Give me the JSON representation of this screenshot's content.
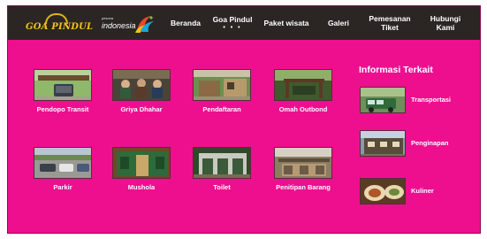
{
  "brand": {
    "logo_text": "GOA PINDUL",
    "partner_small": "pesona",
    "partner_name": "indonesia"
  },
  "nav": {
    "items": [
      {
        "label": "Beranda"
      },
      {
        "label": "Goa Pindul",
        "dots": "• • •"
      },
      {
        "label": "Paket wisata"
      },
      {
        "label": "Galeri"
      },
      {
        "label": "Pemesanan\nTiket"
      },
      {
        "label": "Hubungi\nKami"
      }
    ]
  },
  "facilities": [
    {
      "label": "Pendopo Transit",
      "icon": "pendopo-photo"
    },
    {
      "label": "Griya Dhahar",
      "icon": "restaurant-photo"
    },
    {
      "label": "Pendaftaran",
      "icon": "registration-photo"
    },
    {
      "label": "Omah Outbond",
      "icon": "outbound-photo"
    },
    {
      "label": "Parkir",
      "icon": "parking-photo"
    },
    {
      "label": "Mushola",
      "icon": "prayer-room-photo"
    },
    {
      "label": "Toilet",
      "icon": "toilet-photo"
    },
    {
      "label": "Penitipan Barang",
      "icon": "storage-photo"
    }
  ],
  "sidebar": {
    "title": "Informasi Terkait",
    "items": [
      {
        "label": "Transportasi",
        "icon": "vehicle-photo"
      },
      {
        "label": "Penginapan",
        "icon": "lodging-photo"
      },
      {
        "label": "Kuliner",
        "icon": "food-photo"
      }
    ]
  },
  "colors": {
    "background": "#ee0f8f",
    "navbar": "#2b2623",
    "logo": "#f3c21c",
    "text": "#ffffff"
  }
}
